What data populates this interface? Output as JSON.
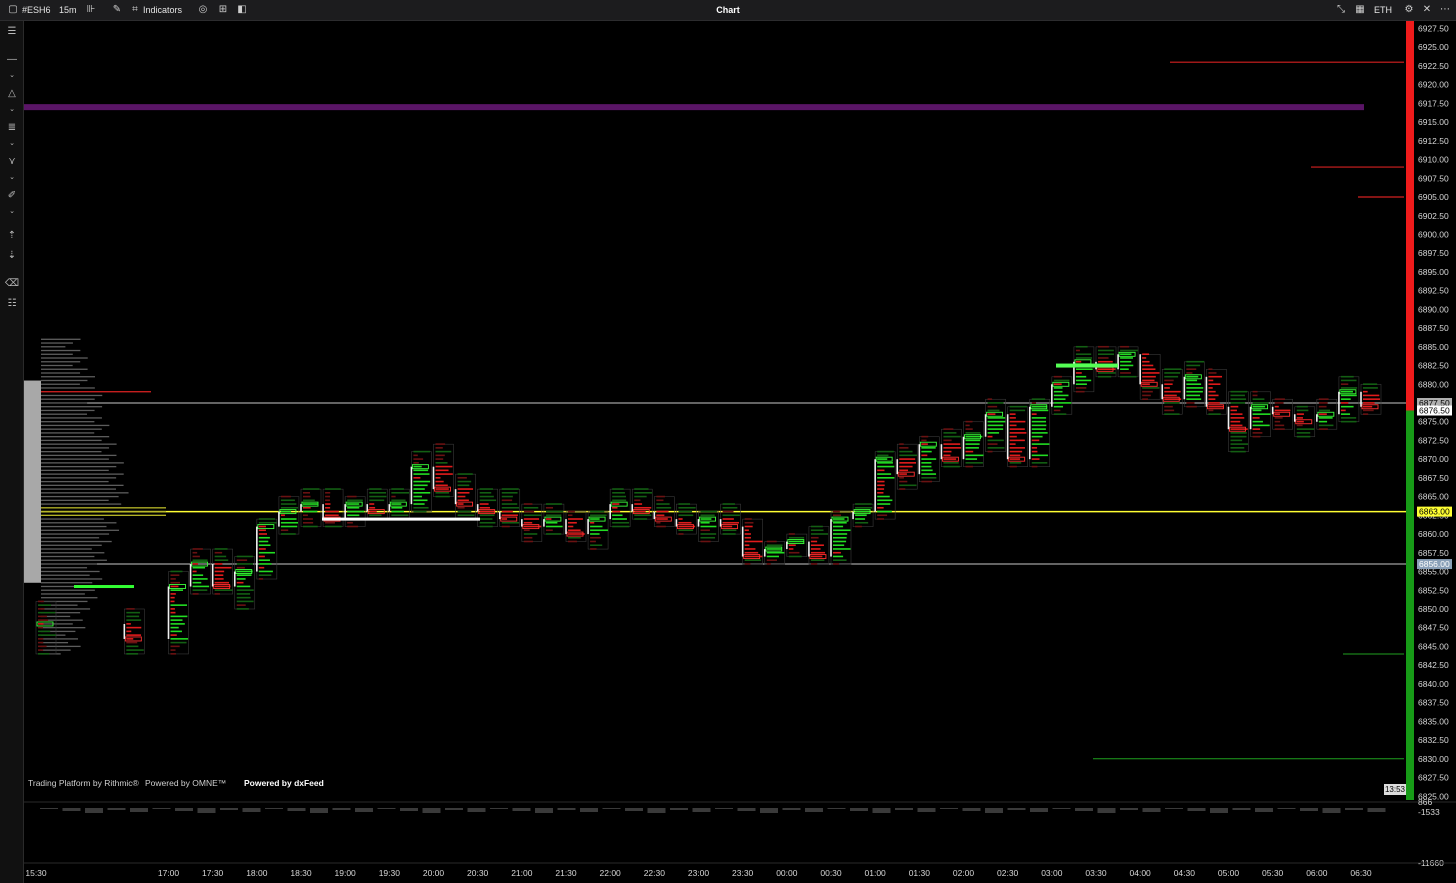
{
  "toolbar": {
    "symbol": "#ESH6",
    "timeframe": "15m",
    "indicators_label": "Indicators",
    "window_title": "Chart",
    "session": "ETH"
  },
  "icons": {
    "symbol": "dropdown-icon",
    "bars": "bar-type-icon",
    "draw": "pencil-icon",
    "indicators": "indicators-icon",
    "template": "template-icon",
    "layout": "layout-icon",
    "panel": "panel-icon",
    "expand": "expand-icon",
    "calendar": "calendar-icon",
    "settings": "gear-icon",
    "close": "close-icon",
    "more": "more-icon"
  },
  "credits": {
    "rithmic": "Trading Platform by Rithmic®",
    "omne": "Powered by OMNE™",
    "dxfeed": "Powered by dxFeed"
  },
  "volume_pane": {
    "value_label": "13:53",
    "top_label": "866",
    "top_value": "-1533",
    "bottom_value": "-11660"
  },
  "price_labels": {
    "high_line": "6877.50",
    "last_price": "6876.50",
    "poc_line": "6863.00",
    "low_line": "6856.00"
  },
  "chart_data": {
    "type": "footprint",
    "y_ticks": [
      "6927.50",
      "6925.00",
      "6922.50",
      "6920.00",
      "6917.50",
      "6915.00",
      "6912.50",
      "6910.00",
      "6907.50",
      "6905.00",
      "6902.50",
      "6900.00",
      "6897.50",
      "6895.00",
      "6892.50",
      "6890.00",
      "6887.50",
      "6885.00",
      "6882.50",
      "6880.00",
      "6877.50",
      "6875.00",
      "6872.50",
      "6870.00",
      "6867.50",
      "6865.00",
      "6862.50",
      "6860.00",
      "6857.50",
      "6855.00",
      "6852.50",
      "6850.00",
      "6847.50",
      "6845.00",
      "6842.50",
      "6840.00",
      "6837.50",
      "6835.00",
      "6832.50",
      "6830.00",
      "6827.50",
      "6825.00"
    ],
    "x_ticks": [
      "15:30",
      "17:00",
      "17:30",
      "18:00",
      "18:30",
      "19:00",
      "19:30",
      "20:00",
      "20:30",
      "21:00",
      "21:30",
      "22:00",
      "22:30",
      "23:00",
      "23:30",
      "00:00",
      "00:30",
      "01:00",
      "01:30",
      "02:00",
      "02:30",
      "03:00",
      "03:30",
      "04:00",
      "04:30",
      "05:00",
      "05:30",
      "06:00",
      "06:30"
    ],
    "ylim": [
      6825.0,
      6927.5
    ],
    "colors": {
      "up": "#22ff22",
      "down": "#ff2020",
      "poc": "#ffff33",
      "level": "#c8c8c8",
      "resistance": "#800080"
    },
    "horizontal_levels": [
      {
        "price": 6877.5,
        "color": "#c8c8c8"
      },
      {
        "price": 6863.0,
        "color": "#ffff33"
      },
      {
        "price": 6856.0,
        "color": "#c8c8c8"
      },
      {
        "price": 6917.0,
        "color": "#5a1566"
      }
    ],
    "candles": [
      {
        "t": "15:30",
        "o": 6848,
        "h": 6851,
        "l": 6844,
        "c": 6848
      },
      {
        "t": "16:30",
        "o": 6848,
        "h": 6850,
        "l": 6844,
        "c": 6846
      },
      {
        "t": "17:00",
        "o": 6846,
        "h": 6855,
        "l": 6844,
        "c": 6853
      },
      {
        "t": "17:15",
        "o": 6853,
        "h": 6858,
        "l": 6852,
        "c": 6856
      },
      {
        "t": "17:30",
        "o": 6856,
        "h": 6858,
        "l": 6852,
        "c": 6853
      },
      {
        "t": "17:45",
        "o": 6853,
        "h": 6857,
        "l": 6850,
        "c": 6855
      },
      {
        "t": "18:00",
        "o": 6855,
        "h": 6862,
        "l": 6854,
        "c": 6861
      },
      {
        "t": "18:15",
        "o": 6861,
        "h": 6865,
        "l": 6860,
        "c": 6863
      },
      {
        "t": "18:30",
        "o": 6863,
        "h": 6866,
        "l": 6861,
        "c": 6864
      },
      {
        "t": "18:45",
        "o": 6864,
        "h": 6866,
        "l": 6861,
        "c": 6862
      },
      {
        "t": "19:00",
        "o": 6862,
        "h": 6865,
        "l": 6861,
        "c": 6864
      },
      {
        "t": "19:15",
        "o": 6864,
        "h": 6866,
        "l": 6862,
        "c": 6863
      },
      {
        "t": "19:30",
        "o": 6863,
        "h": 6866,
        "l": 6862,
        "c": 6864
      },
      {
        "t": "19:45",
        "o": 6864,
        "h": 6871,
        "l": 6863,
        "c": 6869
      },
      {
        "t": "20:00",
        "o": 6869,
        "h": 6872,
        "l": 6865,
        "c": 6866
      },
      {
        "t": "20:15",
        "o": 6866,
        "h": 6868,
        "l": 6862,
        "c": 6864
      },
      {
        "t": "20:30",
        "o": 6864,
        "h": 6866,
        "l": 6861,
        "c": 6863
      },
      {
        "t": "20:45",
        "o": 6863,
        "h": 6866,
        "l": 6861,
        "c": 6862
      },
      {
        "t": "21:00",
        "o": 6862,
        "h": 6864,
        "l": 6859,
        "c": 6861
      },
      {
        "t": "21:15",
        "o": 6861,
        "h": 6864,
        "l": 6860,
        "c": 6862
      },
      {
        "t": "21:30",
        "o": 6862,
        "h": 6863,
        "l": 6859,
        "c": 6860
      },
      {
        "t": "21:45",
        "o": 6860,
        "h": 6863,
        "l": 6858,
        "c": 6862
      },
      {
        "t": "22:00",
        "o": 6862,
        "h": 6866,
        "l": 6861,
        "c": 6864
      },
      {
        "t": "22:15",
        "o": 6864,
        "h": 6866,
        "l": 6862,
        "c": 6863
      },
      {
        "t": "22:30",
        "o": 6863,
        "h": 6865,
        "l": 6861,
        "c": 6862
      },
      {
        "t": "22:45",
        "o": 6862,
        "h": 6864,
        "l": 6860,
        "c": 6861
      },
      {
        "t": "23:00",
        "o": 6861,
        "h": 6863,
        "l": 6859,
        "c": 6862
      },
      {
        "t": "23:15",
        "o": 6862,
        "h": 6864,
        "l": 6860,
        "c": 6861
      },
      {
        "t": "23:30",
        "o": 6861,
        "h": 6862,
        "l": 6856,
        "c": 6857
      },
      {
        "t": "23:45",
        "o": 6857,
        "h": 6859,
        "l": 6856,
        "c": 6858
      },
      {
        "t": "00:00",
        "o": 6858,
        "h": 6860,
        "l": 6857,
        "c": 6859
      },
      {
        "t": "00:15",
        "o": 6859,
        "h": 6861,
        "l": 6856,
        "c": 6857
      },
      {
        "t": "00:30",
        "o": 6857,
        "h": 6863,
        "l": 6856,
        "c": 6862
      },
      {
        "t": "00:45",
        "o": 6862,
        "h": 6864,
        "l": 6861,
        "c": 6863
      },
      {
        "t": "01:00",
        "o": 6863,
        "h": 6871,
        "l": 6862,
        "c": 6870
      },
      {
        "t": "01:15",
        "o": 6870,
        "h": 6872,
        "l": 6866,
        "c": 6868
      },
      {
        "t": "01:30",
        "o": 6868,
        "h": 6873,
        "l": 6867,
        "c": 6872
      },
      {
        "t": "01:45",
        "o": 6872,
        "h": 6874,
        "l": 6869,
        "c": 6870
      },
      {
        "t": "02:00",
        "o": 6870,
        "h": 6875,
        "l": 6869,
        "c": 6873
      },
      {
        "t": "02:15",
        "o": 6873,
        "h": 6878,
        "l": 6871,
        "c": 6876
      },
      {
        "t": "02:30",
        "o": 6876,
        "h": 6877,
        "l": 6869,
        "c": 6870
      },
      {
        "t": "02:45",
        "o": 6870,
        "h": 6878,
        "l": 6869,
        "c": 6877
      },
      {
        "t": "03:00",
        "o": 6877,
        "h": 6881,
        "l": 6876,
        "c": 6880
      },
      {
        "t": "03:15",
        "o": 6880,
        "h": 6885,
        "l": 6879,
        "c": 6883
      },
      {
        "t": "03:30",
        "o": 6883,
        "h": 6885,
        "l": 6881,
        "c": 6882
      },
      {
        "t": "03:45",
        "o": 6882,
        "h": 6885,
        "l": 6881,
        "c": 6884
      },
      {
        "t": "04:00",
        "o": 6884,
        "h": 6884,
        "l": 6878,
        "c": 6880
      },
      {
        "t": "04:15",
        "o": 6880,
        "h": 6882,
        "l": 6876,
        "c": 6878
      },
      {
        "t": "04:30",
        "o": 6878,
        "h": 6883,
        "l": 6877,
        "c": 6881
      },
      {
        "t": "04:45",
        "o": 6881,
        "h": 6882,
        "l": 6876,
        "c": 6877
      },
      {
        "t": "05:00",
        "o": 6877,
        "h": 6879,
        "l": 6871,
        "c": 6874
      },
      {
        "t": "05:15",
        "o": 6874,
        "h": 6879,
        "l": 6873,
        "c": 6877
      },
      {
        "t": "05:30",
        "o": 6877,
        "h": 6878,
        "l": 6874,
        "c": 6876
      },
      {
        "t": "05:45",
        "o": 6876,
        "h": 6877,
        "l": 6873,
        "c": 6875
      },
      {
        "t": "06:00",
        "o": 6875,
        "h": 6878,
        "l": 6874,
        "c": 6876
      },
      {
        "t": "06:15",
        "o": 6876,
        "h": 6881,
        "l": 6875,
        "c": 6879
      },
      {
        "t": "06:30",
        "o": 6879,
        "h": 6880,
        "l": 6876,
        "c": 6877
      }
    ]
  }
}
